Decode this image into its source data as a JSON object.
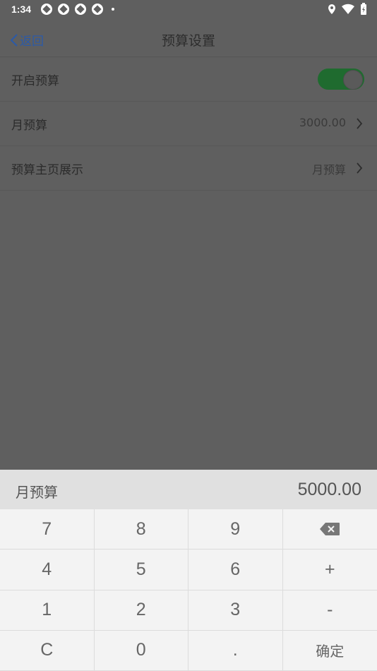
{
  "status_bar": {
    "time": "1:34"
  },
  "nav": {
    "back_label": "返回",
    "title": "预算设置"
  },
  "rows": [
    {
      "label": "开启预算",
      "toggle_on": true
    },
    {
      "label": "月预算",
      "value": "3000.00"
    },
    {
      "label": "预算主页展示",
      "value": "月预算"
    }
  ],
  "keypad": {
    "label": "月预算",
    "value": "5000.00",
    "keys": [
      "7",
      "8",
      "9",
      "⌫",
      "4",
      "5",
      "6",
      "+",
      "1",
      "2",
      "3",
      "-",
      "C",
      "0",
      ".",
      "确定"
    ]
  },
  "colors": {
    "toggle_on": "#1f6b2f",
    "back_link": "#2b5aa8",
    "overlay": "#5f5f5f"
  }
}
